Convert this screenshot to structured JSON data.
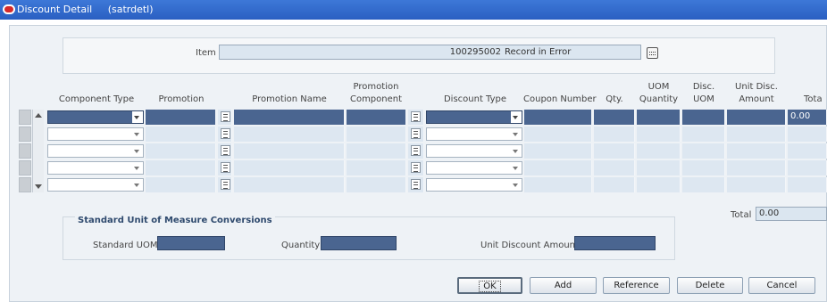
{
  "window": {
    "title": "Discount Detail",
    "module": "(satrdetl)"
  },
  "item": {
    "label": "Item",
    "number": "100295002",
    "description": "Record in Error"
  },
  "columns": [
    {
      "key": "component_type",
      "line1": "",
      "line2": "Component Type"
    },
    {
      "key": "promotion",
      "line1": "",
      "line2": "Promotion"
    },
    {
      "key": "promotion_name",
      "line1": "",
      "line2": "Promotion Name"
    },
    {
      "key": "promotion_component",
      "line1": "Promotion",
      "line2": "Component"
    },
    {
      "key": "discount_type",
      "line1": "",
      "line2": "Discount Type"
    },
    {
      "key": "coupon_number",
      "line1": "",
      "line2": "Coupon Number"
    },
    {
      "key": "qty",
      "line1": "",
      "line2": "Qty."
    },
    {
      "key": "uom_quantity",
      "line1": "UOM",
      "line2": "Quantity"
    },
    {
      "key": "disc_uom",
      "line1": "Disc.",
      "line2": "UOM"
    },
    {
      "key": "unit_disc_amount",
      "line1": "Unit Disc.",
      "line2": "Amount"
    },
    {
      "key": "total",
      "line1": "",
      "line2": "Tota"
    }
  ],
  "rows": [
    {
      "selected": true,
      "total": "0.00"
    },
    {
      "selected": false,
      "total": ""
    },
    {
      "selected": false,
      "total": ""
    },
    {
      "selected": false,
      "total": ""
    },
    {
      "selected": false,
      "total": ""
    }
  ],
  "total": {
    "label": "Total",
    "value": "0.00"
  },
  "standard_uom": {
    "title": "Standard Unit of Measure Conversions",
    "standard_uom_label": "Standard UOM",
    "quantity_label": "Quantity",
    "unit_discount_amount_label": "Unit Discount Amount"
  },
  "buttons": {
    "ok": "OK",
    "add": "Add",
    "reference": "Reference",
    "delete": "Delete",
    "cancel": "Cancel"
  },
  "colors": {
    "title_bar": "#2e6ad0",
    "selected_row": "#4a6590",
    "grid_cell": "#dde7f1",
    "logo": "#d62a2a"
  }
}
